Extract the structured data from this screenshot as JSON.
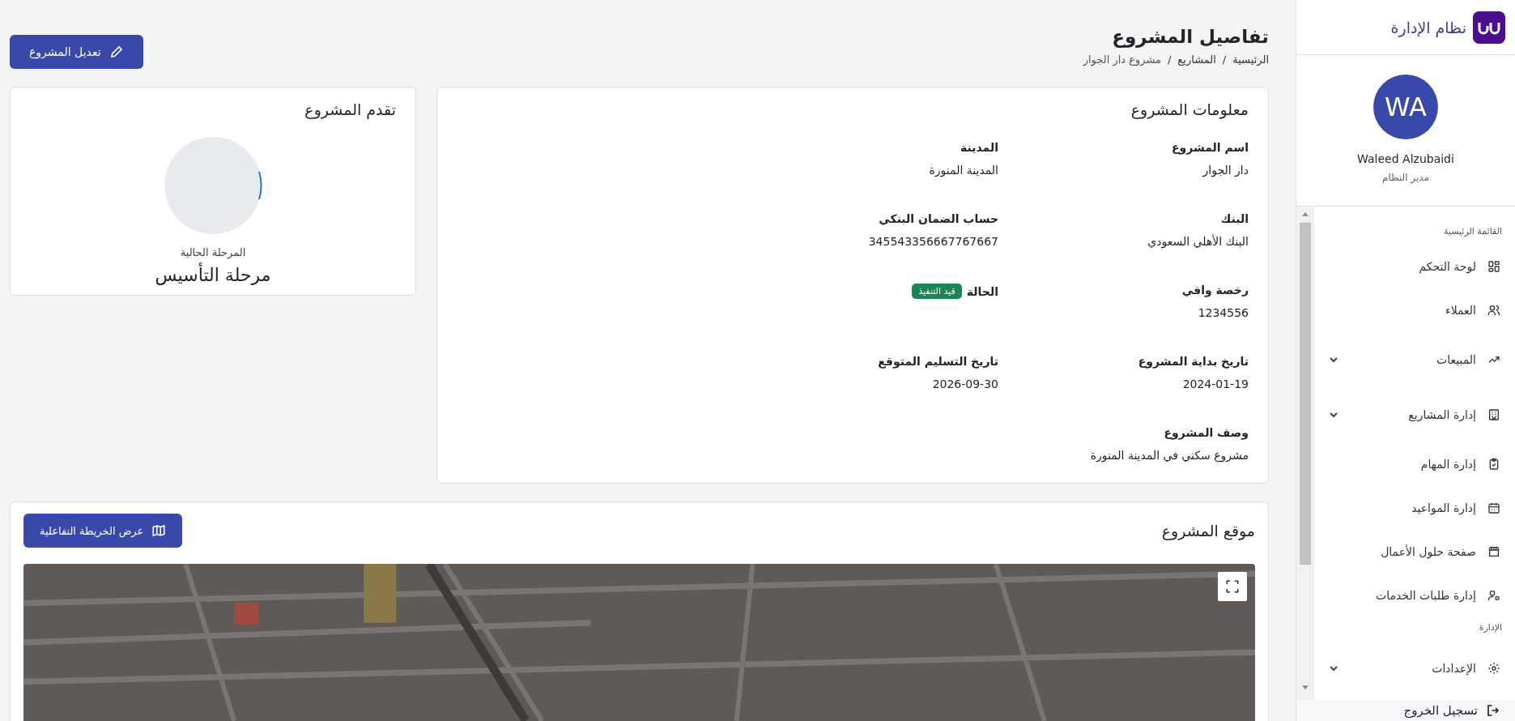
{
  "sidebar": {
    "brand": "نظام الإدارة",
    "user": {
      "initials": "WA",
      "name": "Waleed Alzubaidi",
      "role": "مدير النظام"
    },
    "sections": [
      {
        "title": "القائمة الرئيسية",
        "items": [
          {
            "label": "لوحة التحكم"
          },
          {
            "label": "العملاء"
          },
          {
            "label": "المبيعات",
            "expanded": false
          },
          {
            "label": "إدارة المشاريع",
            "expanded": false
          },
          {
            "label": "إدارة المهام"
          },
          {
            "label": "إدارة المواعيد"
          },
          {
            "label": "صفحة حلول الأعمال"
          },
          {
            "label": "إدارة طلبات الخدمات"
          }
        ]
      },
      {
        "title": "الإدارة",
        "items": [
          {
            "label": "الإعدادات",
            "expanded": false
          }
        ]
      }
    ],
    "logout": "تسجيل الخروج"
  },
  "header": {
    "title": "تفاصيل المشروع",
    "breadcrumb": [
      "الرئيسية",
      "المشاريع",
      "مشروع دار الجوار"
    ],
    "separator": "/",
    "edit_button": "تعديل المشروع"
  },
  "info": {
    "title": "معلومات المشروع",
    "fields": [
      {
        "label": "اسم المشروع",
        "value": "دار الجوار",
        "kind": "text"
      },
      {
        "label": "المدينة",
        "value": "المدينة المنورة",
        "kind": "text"
      },
      {
        "label": "البنك",
        "value": "البنك الأهلي السعودي",
        "kind": "text"
      },
      {
        "label": "حساب الضمان البنكي",
        "value": "345543356667767667",
        "kind": "text"
      },
      {
        "label": "رخصة وافي",
        "value": "1234556",
        "kind": "text"
      },
      {
        "label": "الحالة",
        "value": "قيد التنفيذ",
        "kind": "badge",
        "color": "#198754"
      },
      {
        "label": "تاريخ بداية المشروع",
        "value": "2024-01-19",
        "kind": "text"
      },
      {
        "label": "تاريخ التسليم المتوقع",
        "value": "2026-09-30",
        "kind": "text"
      },
      {
        "label": "وصف المشروع",
        "value": "مشروع سكني في المدينة المنورة",
        "kind": "text"
      }
    ]
  },
  "progress": {
    "title": "تقدم المشروع",
    "caption": "المرحلة الحالية",
    "stage": "مرحلة التأسيس"
  },
  "location": {
    "title": "موقع المشروع",
    "map_button": "عرض الخريطة التفاعلية"
  }
}
